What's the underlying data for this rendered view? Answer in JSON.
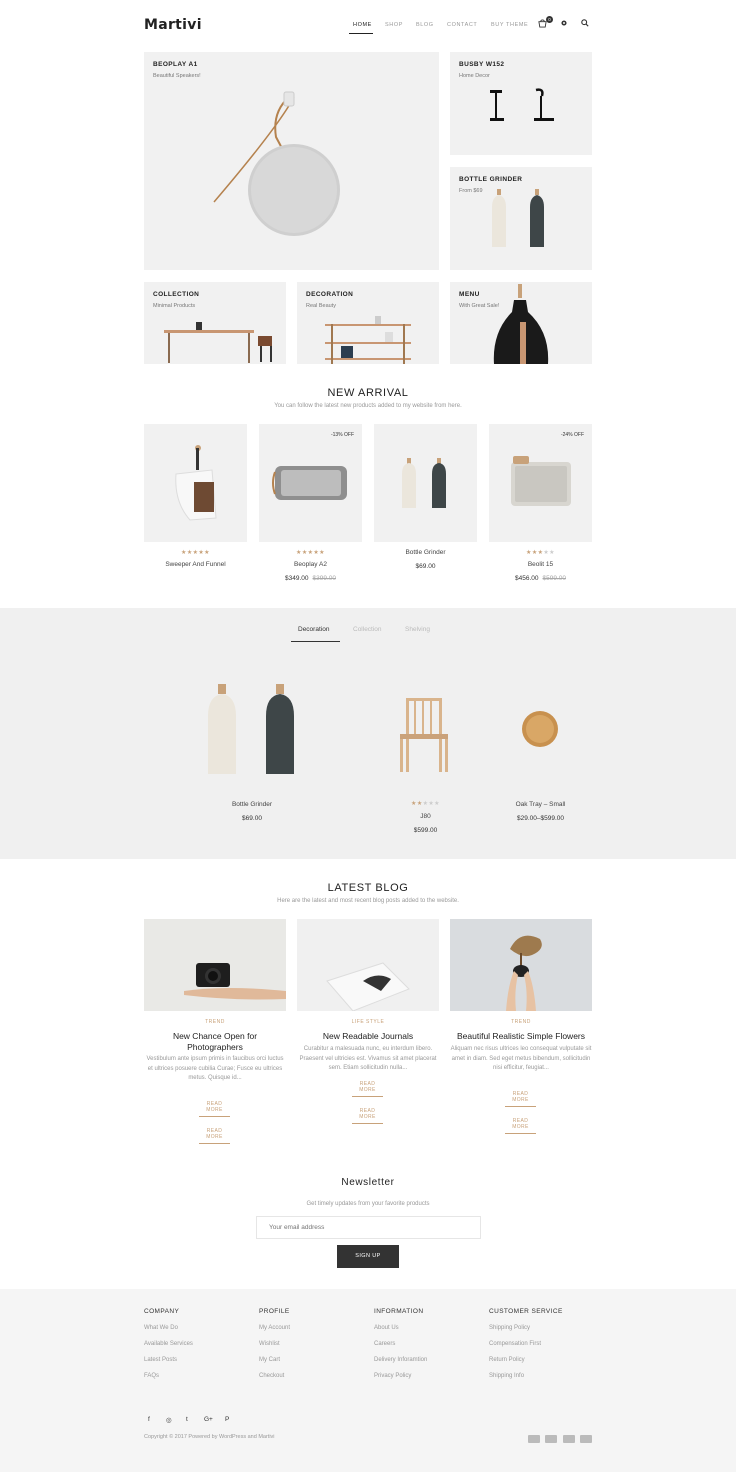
{
  "header": {
    "logo": "Martivi",
    "nav": [
      "HOME",
      "SHOP",
      "BLOG",
      "CONTACT",
      "BUY THEME"
    ],
    "cart_count": "0",
    "icons": [
      "cart-icon",
      "gear-icon",
      "search-icon"
    ]
  },
  "hero": {
    "main": {
      "title": "BEOPLAY A1",
      "sub": "Beautiful Speakers!"
    },
    "busby": {
      "title": "BUSBY W152",
      "sub": "Home Decor"
    },
    "grinder": {
      "title": "BOTTLE GRINDER",
      "sub": "From $69"
    },
    "collection": {
      "title": "COLLECTION",
      "sub": "Minimal Products"
    },
    "decoration": {
      "title": "DECORATION",
      "sub": "Real Beauty"
    },
    "menu": {
      "title": "MENU",
      "sub": "With Great Sale!"
    }
  },
  "new_arrival": {
    "title": "NEW ARRIVAL",
    "subtitle": "You can follow the latest new products added to my website from here.",
    "products": [
      {
        "name": "Sweeper And Funnel",
        "rating": 5,
        "price": "",
        "old_price": "",
        "badge": ""
      },
      {
        "name": "Beoplay A2",
        "rating": 5,
        "price": "$349.00",
        "old_price": "$399.00",
        "badge": "-13% OFF"
      },
      {
        "name": "Bottle Grinder",
        "rating": 0,
        "price": "$69.00",
        "old_price": "",
        "badge": ""
      },
      {
        "name": "Beolit 15",
        "rating": 3,
        "price": "$456.00",
        "old_price": "$599.00",
        "badge": "-24% OFF"
      }
    ]
  },
  "tabs": {
    "items": [
      "Decoration",
      "Collection",
      "Shelving"
    ],
    "products": [
      {
        "name": "Bottle Grinder",
        "rating": 0,
        "price": "$69.00"
      },
      {
        "name": "J80",
        "rating": 2,
        "price": "$599.00"
      },
      {
        "name": "Oak Tray – Small",
        "rating": 0,
        "price": "$29.00–$599.00"
      }
    ]
  },
  "blog": {
    "title": "LATEST BLOG",
    "subtitle": "Here are the latest and most recent blog posts added to the website.",
    "posts": [
      {
        "cat": "TREND",
        "title": "New Chance Open for Photographers",
        "excerpt": "Vestibulum ante ipsum primis in faucibus orci luctus et ultrices posuere cubilia Curae; Fusce eu ultrices metus. Quisque id...",
        "more": "READ MORE"
      },
      {
        "cat": "LIFE STYLE",
        "title": "New Readable Journals",
        "excerpt": "Curabitur a malesuada nunc, eu interdum libero. Praesent vel ultricies est. Vivamus sit amet placerat sem. Etiam sollicitudin nulla...",
        "more": "READ MORE"
      },
      {
        "cat": "TREND",
        "title": "Beautiful Realistic Simple Flowers",
        "excerpt": "Aliquam nec risus ultrices leo consequat vulputate sit amet in diam. Sed eget metus bibendum, sollicitudin nisi efficitur, feugiat...",
        "more": "READ MORE"
      }
    ]
  },
  "newsletter": {
    "title": "Newsletter",
    "subtitle": "Get timely updates from your favorite products",
    "placeholder": "Your email address",
    "button": "SIGN UP"
  },
  "footer": {
    "columns": [
      {
        "title": "COMPANY",
        "links": [
          "What We Do",
          "Available Services",
          "Latest Posts",
          "FAQs"
        ]
      },
      {
        "title": "PROFILE",
        "links": [
          "My Account",
          "Wishlist",
          "My Cart",
          "Checkout"
        ]
      },
      {
        "title": "INFORMATION",
        "links": [
          "About Us",
          "Careers",
          "Delivery Inforamtion",
          "Privacy Policy"
        ]
      },
      {
        "title": "CUSTOMER SERVICE",
        "links": [
          "Shipping Policy",
          "Compensation First",
          "Return Policy",
          "Shipping Info"
        ]
      }
    ],
    "social": [
      "f",
      "◎",
      "t",
      "G+",
      "P"
    ],
    "copyright": "Copyright © 2017 Powered by WordPress and Martivi"
  },
  "colors": {
    "accent": "#c8a27a",
    "dark": "#333333",
    "tile_bg": "#f1f1f1"
  }
}
